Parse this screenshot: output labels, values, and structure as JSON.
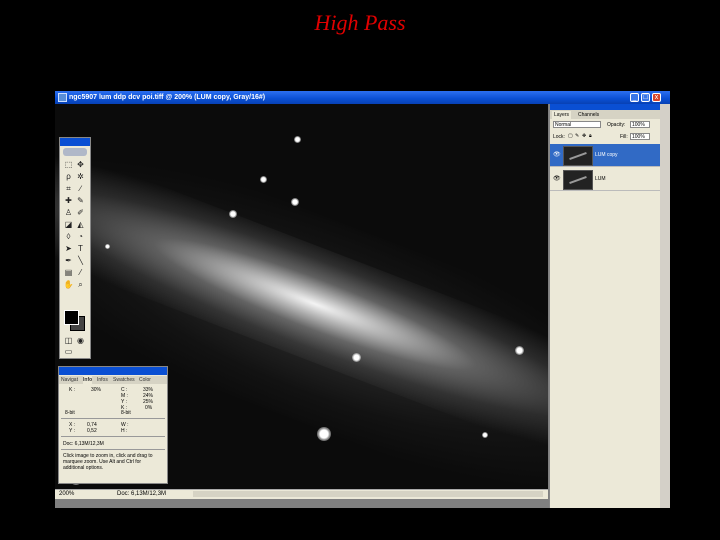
{
  "slide": {
    "title": "High Pass"
  },
  "window": {
    "title": "ngc5907 lum ddp dcv poi.tiff @ 200% (LUM copy, Gray/16#)",
    "minimize": "_",
    "maximize": "□",
    "close": "x"
  },
  "status": {
    "zoom": "200%",
    "doc": "Doc: 6,13M/12,3M"
  },
  "info_panel": {
    "tabs": [
      "Navigat",
      "Info",
      "Infos",
      "Swatches",
      "Color"
    ],
    "k_label": "K :",
    "k_value": "30%",
    "c_label": "C :",
    "c_value": "33%",
    "m_label": "M :",
    "m_value": "24%",
    "y_label": "Y :",
    "y_value": "25%",
    "k2_label": "K :",
    "k2_value": "0%",
    "bit1": "8-bit",
    "bit2": "8-bit",
    "x_label": "X :",
    "x_value": "0,74",
    "yy_label": "Y :",
    "yy_value": "0,52",
    "w_label": "W :",
    "h_label": "H :",
    "doc": "Doc: 6,13M/12,3M",
    "help": "Click image to zoom in, click and drag to marquee zoom. Use Alt and Ctrl for additional options."
  },
  "layers_panel": {
    "tabs": [
      "Layers",
      "Channels"
    ],
    "blend_mode": "Normal",
    "opacity_label": "Opacity:",
    "opacity_value": "100%",
    "lock_label": "Lock:",
    "fill_label": "Fill:",
    "fill_value": "100%",
    "layers": [
      {
        "name": "LUM copy",
        "selected": true
      },
      {
        "name": "LUM",
        "selected": false
      }
    ]
  },
  "icons": {
    "eye": "eye-icon",
    "tools": [
      "marquee-icon",
      "move-icon",
      "lasso-icon",
      "magic-wand-icon",
      "crop-icon",
      "slice-icon",
      "healing-icon",
      "brush-icon",
      "stamp-icon",
      "history-brush-icon",
      "eraser-icon",
      "gradient-icon",
      "blur-icon",
      "dodge-icon",
      "path-select-icon",
      "type-icon",
      "pen-icon",
      "line-icon",
      "notes-icon",
      "eyedropper-icon",
      "hand-icon",
      "zoom-icon"
    ]
  }
}
